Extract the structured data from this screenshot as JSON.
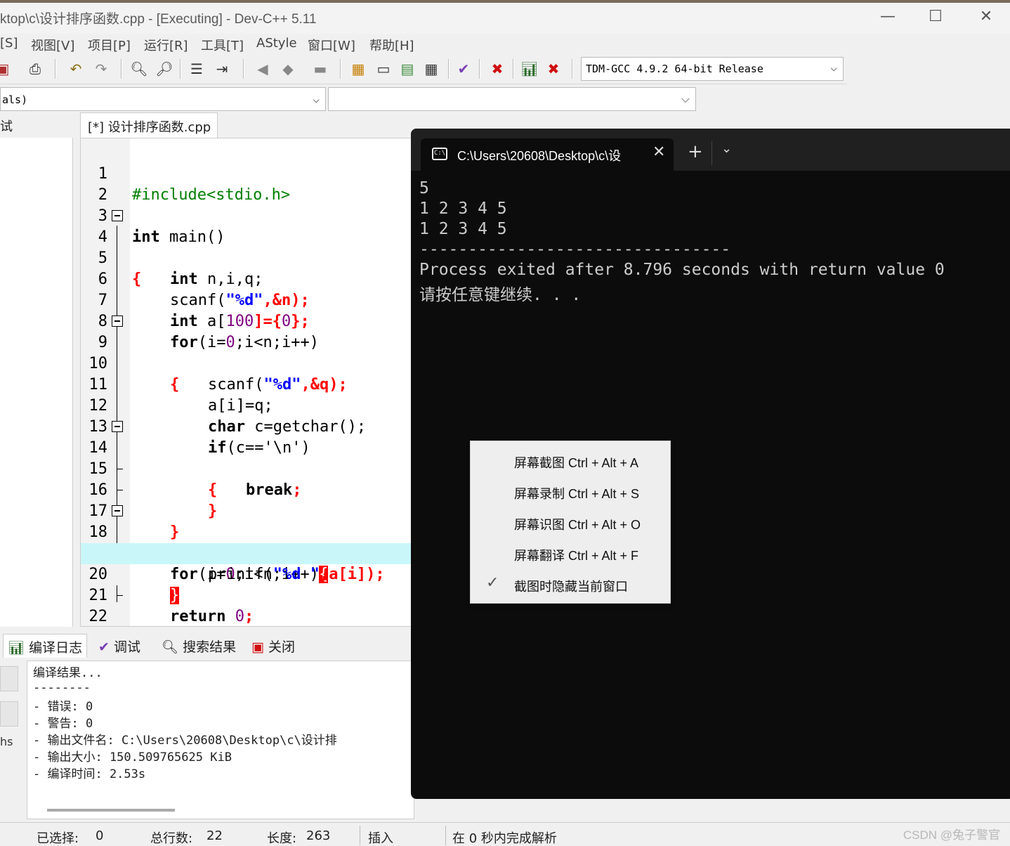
{
  "window": {
    "title": "ktop\\c\\设计排序函数.cpp - [Executing] - Dev-C++ 5.11",
    "min": "—",
    "max": "☐",
    "close": "✕"
  },
  "menubar": [
    "[S]",
    "视图[V]",
    "项目[P]",
    "运行[R]",
    "工具[T]",
    "AStyle",
    "窗口[W]",
    "帮助[H]"
  ],
  "toolbar": {
    "compiler": "TDM-GCC 4.9.2 64-bit Release",
    "class_select": "als)"
  },
  "side_tab": "试",
  "editor": {
    "file_tab": "[*] 设计排序函数.cpp",
    "line_numbers": [
      "1",
      "2",
      "3",
      "4",
      "5",
      "6",
      "7",
      "8",
      "9",
      "10",
      "11",
      "12",
      "13",
      "14",
      "15",
      "16",
      "17",
      "18",
      "19",
      "20",
      "21",
      "22"
    ],
    "code": {
      "l1": "#include<stdio.h>",
      "l3_kw": "int",
      "l3_rest": " main()",
      "l4": "{",
      "l5_kw": "int",
      "l5_rest": " n,i,q;",
      "l6_a": "scanf(",
      "l6_str": "\"%d\"",
      "l6_b": ",&n);",
      "l7_kw": "int",
      "l7_a": " a[",
      "l7_num": "100",
      "l7_b": "]={",
      "l7_num2": "0",
      "l7_c": "};",
      "l8_kw": "for",
      "l8_a": "(i=",
      "l8_num": "0",
      "l8_b": ";i<n;i++)",
      "l9": "{",
      "l10_a": "scanf(",
      "l10_str": "\"%d\"",
      "l10_b": ",&q);",
      "l11": "a[i]=q;",
      "l12_kw": "char",
      "l12_rest": " c=getchar();",
      "l13_kw": "if",
      "l13_a": "(c==",
      "l13_chr": "'\\n'",
      "l13_b": ")",
      "l14": "{",
      "l15_kw": "break",
      "l15_rest": ";",
      "l16": "}",
      "l17": "}",
      "l18_kw": "for",
      "l18_a": "(i=",
      "l18_num": "0",
      "l18_b": ";i<n;i++)",
      "l18_brace": "{",
      "l19_a": "printf(",
      "l19_str": "\"%d \"",
      "l19_b": ",a[i]);",
      "l20": "}",
      "l21_kw": "return",
      "l21_num": " 0",
      "l21_b": ";",
      "l22": "}"
    }
  },
  "bottom_tabs": [
    "编译日志",
    "调试",
    "搜索结果",
    "关闭"
  ],
  "compile_log": [
    "编译结果...",
    "--------",
    "- 错误: 0",
    "- 警告: 0",
    "- 输出文件名: C:\\Users\\20608\\Desktop\\c\\设计排",
    "- 输出大小: 150.509765625 KiB",
    "- 编译时间: 2.53s"
  ],
  "left_panel_text": "hs",
  "statusbar": {
    "selected_label": "已选择:",
    "selected_value": "0",
    "lines_label": "总行数:",
    "lines_value": "22",
    "length_label": "长度:",
    "length_value": "263",
    "mode": "插入",
    "parse": "在 0 秒内完成解析"
  },
  "terminal": {
    "tab_title": "C:\\Users\\20608\\Desktop\\c\\设",
    "icon_text": "C:\\",
    "close": "✕",
    "new_tab": "+",
    "dropdown": "⌄",
    "lines": [
      "5",
      "1 2 3 4 5",
      "1 2 3 4 5",
      "--------------------------------",
      "Process exited after 8.796 seconds with return value 0",
      "请按任意键继续. . ."
    ]
  },
  "context_menu": {
    "items": [
      "屏幕截图 Ctrl + Alt + A",
      "屏幕录制 Ctrl + Alt + S",
      "屏幕识图 Ctrl + Alt + O",
      "屏幕翻译 Ctrl + Alt + F",
      "截图时隐藏当前窗口"
    ],
    "checked_index": 4
  },
  "watermark": "CSDN @兔子警官"
}
